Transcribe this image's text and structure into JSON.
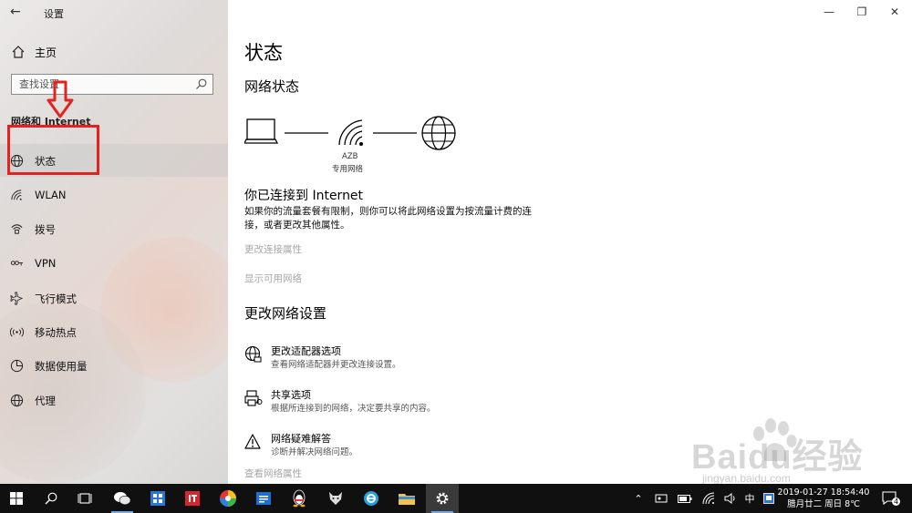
{
  "window": {
    "title": "设置"
  },
  "sidebar": {
    "home_label": "主页",
    "search_placeholder": "查找设置",
    "section_heading": "网络和 Internet",
    "items": [
      {
        "label": "状态",
        "icon": "globe-icon",
        "selected": true
      },
      {
        "label": "WLAN",
        "icon": "wifi-icon"
      },
      {
        "label": "拨号",
        "icon": "dialup-icon"
      },
      {
        "label": "VPN",
        "icon": "vpn-icon"
      },
      {
        "label": "飞行模式",
        "icon": "airplane-icon"
      },
      {
        "label": "移动热点",
        "icon": "hotspot-icon"
      },
      {
        "label": "数据使用量",
        "icon": "data-usage-icon"
      },
      {
        "label": "代理",
        "icon": "globe-icon"
      }
    ]
  },
  "main": {
    "title": "状态",
    "network_status_heading": "网络状态",
    "network_name": "AZB",
    "network_type": "专用网络",
    "connected_text": "你已连接到 Internet",
    "description": "如果你的流量套餐有限制，则你可以将此网络设置为按流量计费的连接，或者更改其他属性。",
    "change_properties_link": "更改连接属性",
    "show_networks_link": "显示可用网络",
    "change_settings_heading": "更改网络设置",
    "options": [
      {
        "title": "更改适配器选项",
        "desc": "查看网络适配器并更改连接设置。",
        "icon": "adapter-icon"
      },
      {
        "title": "共享选项",
        "desc": "根据所连接到的网络，决定要共享的内容。",
        "icon": "sharing-icon"
      },
      {
        "title": "网络疑难解答",
        "desc": "诊断并解决网络问题。",
        "icon": "warning-icon"
      }
    ],
    "view_properties_link": "查看网络属性"
  },
  "watermark": {
    "text": "Baidu经验",
    "sub": "jingyan.baidu.com"
  },
  "taskbar": {
    "tray_input_lang": "中",
    "clock_line1": "2019-01-27 18:54:40",
    "clock_line2": "腊月廿二 周日 8℃",
    "notification_count": "4"
  },
  "colors": {
    "annotation_red": "#e52222",
    "taskbar_bg": "#101010",
    "muted_link": "#a7a7a7"
  }
}
